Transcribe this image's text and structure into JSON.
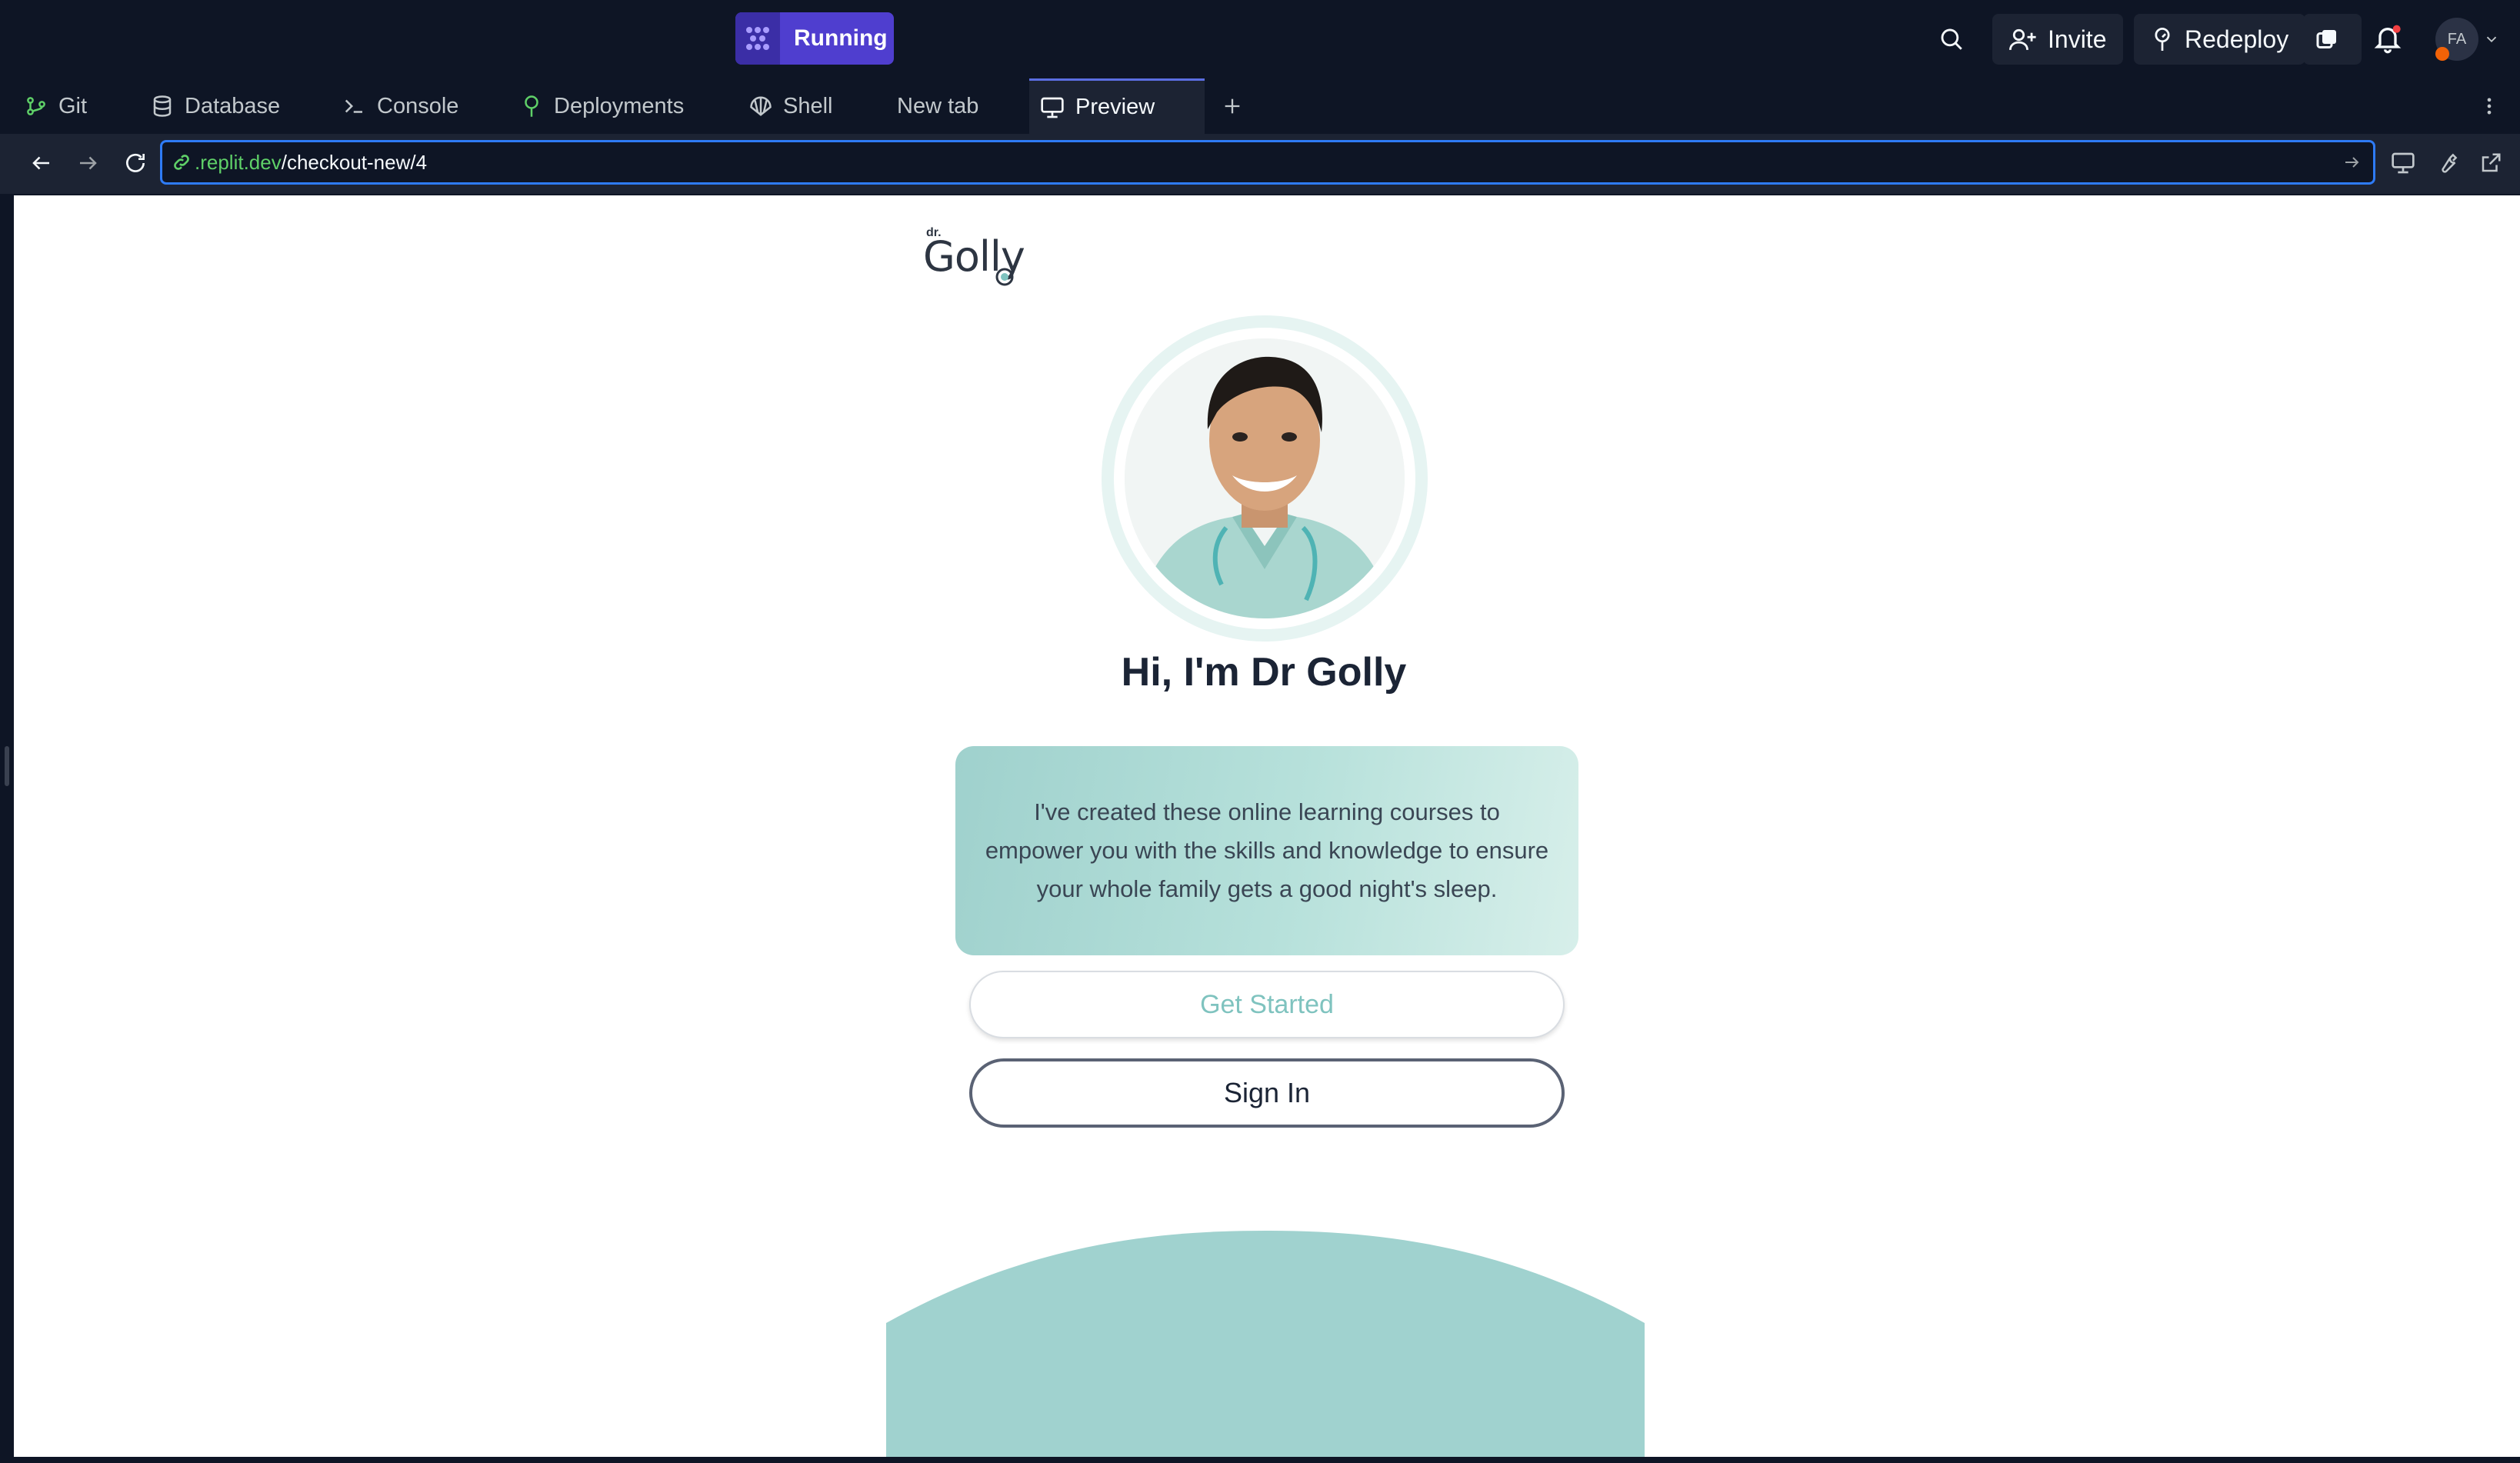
{
  "topbar": {
    "run_status": "Running",
    "invite_label": "Invite",
    "redeploy_label": "Redeploy",
    "user_initials": "FA"
  },
  "tabs": [
    {
      "label": "Git"
    },
    {
      "label": "Database"
    },
    {
      "label": "Console"
    },
    {
      "label": "Deployments"
    },
    {
      "label": "Shell"
    },
    {
      "label": "New tab"
    },
    {
      "label": "Preview",
      "active": true
    }
  ],
  "address": {
    "host": ".replit.dev",
    "path": "/checkout-new/4"
  },
  "page": {
    "logo_small": "dr.",
    "logo_word": "Golly",
    "headline": "Hi, I'm Dr Golly",
    "intro": "I've created these online learning courses to empower you with the skills and knowledge to ensure your whole family gets a good night's sleep.",
    "get_started": "Get Started",
    "sign_in": "Sign In"
  },
  "colors": {
    "accent_teal": "#a0d2cf",
    "running_purple": "#4f3ecf",
    "url_focus": "#2e7bf6",
    "host_green": "#5fd068"
  }
}
